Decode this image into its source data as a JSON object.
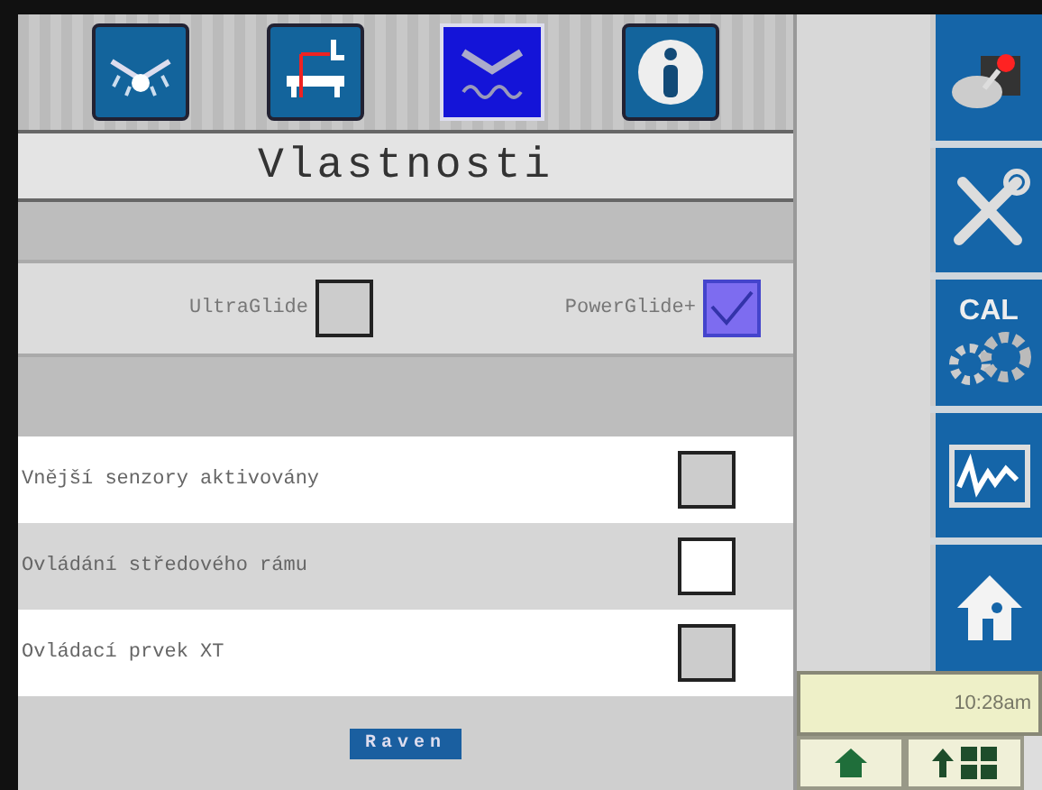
{
  "tabs": [
    {
      "selected": false
    },
    {
      "selected": false
    },
    {
      "selected": true
    },
    {
      "selected": false
    }
  ],
  "title": "Vlastnosti",
  "glide_options": [
    {
      "label": "UltraGlide",
      "checked": false
    },
    {
      "label": "PowerGlide+",
      "checked": true
    }
  ],
  "features": [
    {
      "label": "Vnější senzory aktivovány",
      "checked": false
    },
    {
      "label": "Ovládání středového rámu",
      "checked": false
    },
    {
      "label": "Ovládací prvek XT",
      "checked": false
    }
  ],
  "button": "Raven",
  "calibration_label": "CAL",
  "clock": "10:28am"
}
